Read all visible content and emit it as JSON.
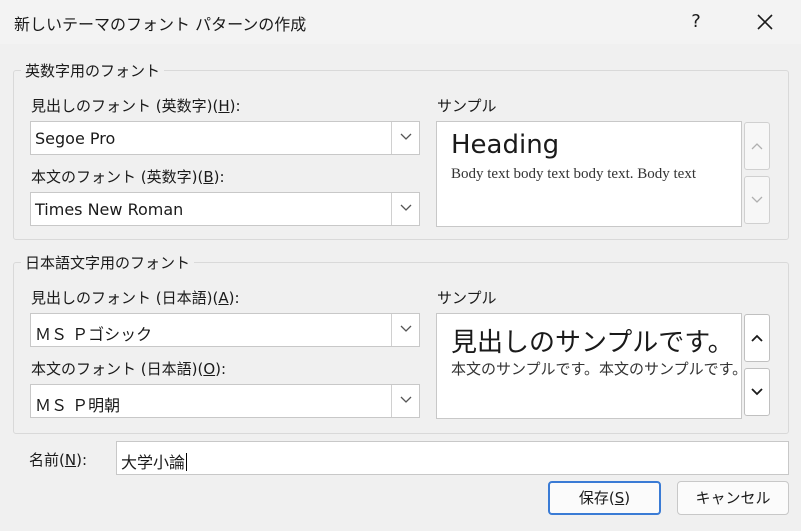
{
  "dialog": {
    "title": "新しいテーマのフォント パターンの作成",
    "help_label": "?",
    "close_icon": "close-icon"
  },
  "latin": {
    "group_label": "英数字用のフォント",
    "heading_label_pre": "見出しのフォント (英数字)(",
    "heading_label_key": "H",
    "heading_label_post": "):",
    "heading_value": "Segoe Pro",
    "body_label_pre": "本文のフォント (英数字)(",
    "body_label_key": "B",
    "body_label_post": "):",
    "body_value": "Times New Roman",
    "sample_label": "サンプル",
    "sample_heading": "Heading",
    "sample_body": "Body text body text body text. Body text"
  },
  "japanese": {
    "group_label": "日本語文字用のフォント",
    "heading_label_pre": "見出しのフォント (日本語)(",
    "heading_label_key": "A",
    "heading_label_post": "):",
    "heading_value": "ＭＳ Ｐゴシック",
    "body_label_pre": "本文のフォント (日本語)(",
    "body_label_key": "O",
    "body_label_post": "):",
    "body_value": "ＭＳ Ｐ明朝",
    "sample_label": "サンプル",
    "sample_heading": "見出しのサンプルです。",
    "sample_body": "本文のサンプルです。本文のサンプルです。"
  },
  "name": {
    "label_pre": "名前(",
    "label_key": "N",
    "label_post": "):",
    "value": "大学小論"
  },
  "buttons": {
    "save_pre": "保存(",
    "save_key": "S",
    "save_post": ")",
    "cancel": "キャンセル"
  }
}
